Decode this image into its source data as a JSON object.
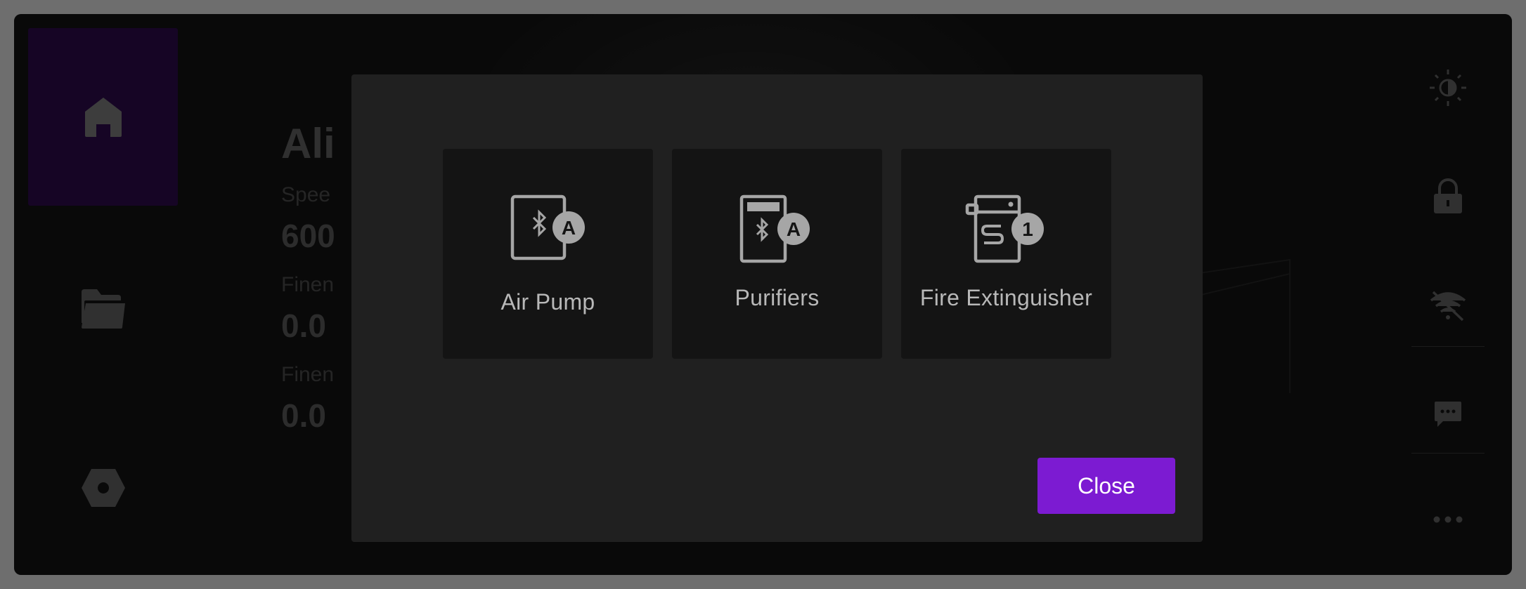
{
  "background": {
    "title": "Ali",
    "fields": [
      {
        "label": "Spee",
        "value": "600"
      },
      {
        "label": "Finen",
        "value": "0.0"
      },
      {
        "label": "Finen",
        "value": "0.0"
      }
    ]
  },
  "nav": {
    "items": [
      {
        "icon": "home-icon",
        "active": true
      },
      {
        "icon": "folder-icon",
        "active": false
      },
      {
        "icon": "hex-nut-icon",
        "active": false
      }
    ]
  },
  "right_bar": {
    "items": [
      "brightness-icon",
      "lock-icon",
      "wifi-off-icon",
      "message-icon",
      "more-icon"
    ]
  },
  "modal": {
    "tiles": [
      {
        "label": "Air Pump",
        "icon": "bluetooth-device-icon",
        "badge": "A"
      },
      {
        "label": "Purifiers",
        "icon": "bluetooth-purifier-icon",
        "badge": "A"
      },
      {
        "label": "Fire Extinguisher",
        "icon": "fire-extinguisher-icon",
        "badge": "1"
      }
    ],
    "close_label": "Close"
  },
  "colors": {
    "accent": "#7c1bd2",
    "active_nav": "#22093a",
    "modal_bg": "#202020",
    "tile_bg": "#141414"
  }
}
